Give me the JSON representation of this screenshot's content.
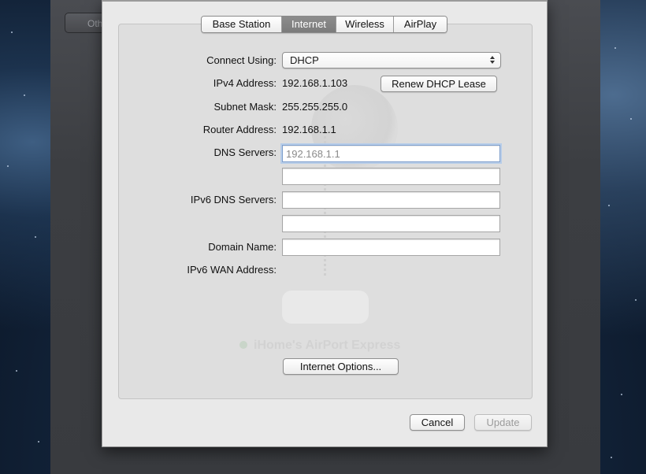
{
  "background_window": {
    "tab_label": "Other AirPort Base Stations"
  },
  "tabs": [
    {
      "label": "Base Station",
      "active": false
    },
    {
      "label": "Internet",
      "active": true
    },
    {
      "label": "Wireless",
      "active": false
    },
    {
      "label": "AirPlay",
      "active": false
    }
  ],
  "form": {
    "connect_using": {
      "label": "Connect Using:",
      "value": "DHCP"
    },
    "ipv4": {
      "label": "IPv4 Address:",
      "value": "192.168.1.103"
    },
    "renew_button": "Renew DHCP Lease",
    "subnet": {
      "label": "Subnet Mask:",
      "value": "255.255.255.0"
    },
    "router": {
      "label": "Router Address:",
      "value": "192.168.1.1"
    },
    "dns": {
      "label": "DNS Servers:",
      "field1_placeholder": "192.168.1.1",
      "field1_value": "",
      "field2_value": ""
    },
    "ipv6_dns": {
      "label": "IPv6 DNS Servers:",
      "field1_value": "",
      "field2_value": ""
    },
    "domain": {
      "label": "Domain Name:",
      "value": ""
    },
    "ipv6_wan": {
      "label": "IPv6 WAN Address:",
      "value": ""
    },
    "internet_options_button": "Internet Options..."
  },
  "watermark": {
    "device_name": "iHome's AirPort Express"
  },
  "footer": {
    "cancel": "Cancel",
    "update": "Update"
  },
  "colors": {
    "active_tab": "#838383",
    "focus_ring": "#b7cde9",
    "panel": "#dedede",
    "sheet": "#e9e9e9"
  },
  "icons": {
    "popup": "up-down-arrows-icon"
  }
}
